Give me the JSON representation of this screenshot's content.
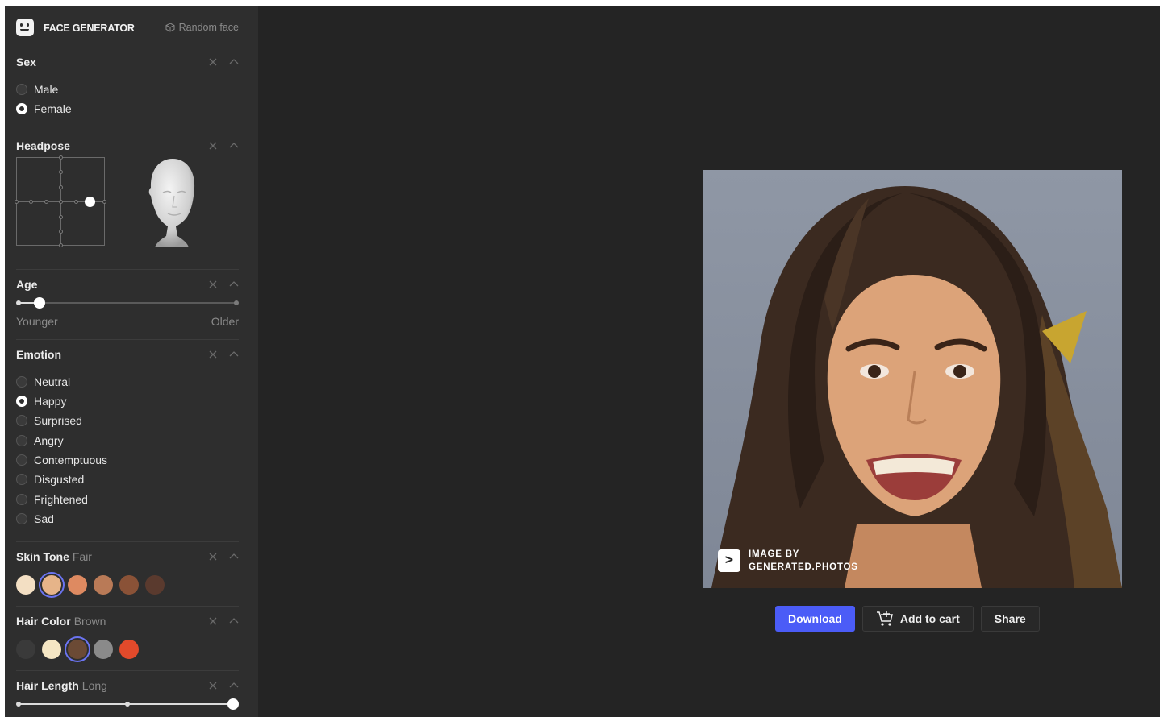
{
  "app": {
    "title": "FACE GENERATOR",
    "random_face_label": "Random face"
  },
  "sex": {
    "title": "Sex",
    "options": [
      "Male",
      "Female"
    ],
    "selected": "Female"
  },
  "headpose": {
    "title": "Headpose"
  },
  "age": {
    "title": "Age",
    "min_label": "Younger",
    "max_label": "Older",
    "value_fraction": 0.1
  },
  "emotion": {
    "title": "Emotion",
    "options": [
      "Neutral",
      "Happy",
      "Surprised",
      "Angry",
      "Contemptuous",
      "Disgusted",
      "Frightened",
      "Sad"
    ],
    "selected": "Happy"
  },
  "skin_tone": {
    "title": "Skin Tone",
    "selected_label": "Fair",
    "colors": [
      "#f3dfc3",
      "#e6b489",
      "#de8a61",
      "#b97a57",
      "#8a5237",
      "#5a3a2e"
    ],
    "selected_index": 1
  },
  "hair_color": {
    "title": "Hair Color",
    "selected_label": "Brown",
    "colors": [
      "#3a3a3a",
      "#f5e6c4",
      "#6b4a35",
      "#8a8a8a",
      "#e24a2b"
    ],
    "selected_index": 2
  },
  "hair_length": {
    "title": "Hair Length",
    "selected_label": "Long",
    "value_fraction": 1.0
  },
  "image": {
    "watermark_line1": "IMAGE BY",
    "watermark_line2": "GENERATED.PHOTOS",
    "watermark_mark": ">"
  },
  "actions": {
    "download": "Download",
    "add_to_cart": "Add to cart",
    "share": "Share"
  },
  "colors": {
    "accent": "#4b5cf7",
    "sidebar_bg": "#2e2e2e",
    "main_bg": "#242424"
  }
}
